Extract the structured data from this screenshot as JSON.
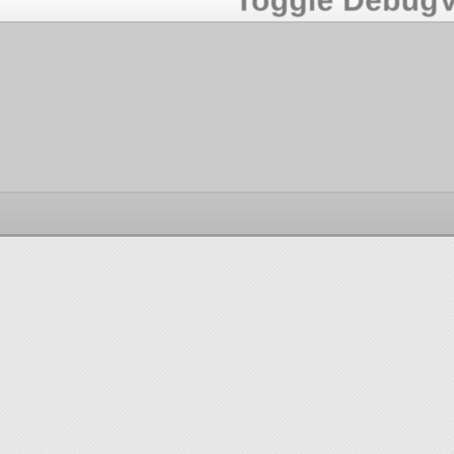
{
  "menubar": {
    "items": [
      {
        "label": "Toggle DebugV"
      }
    ]
  }
}
